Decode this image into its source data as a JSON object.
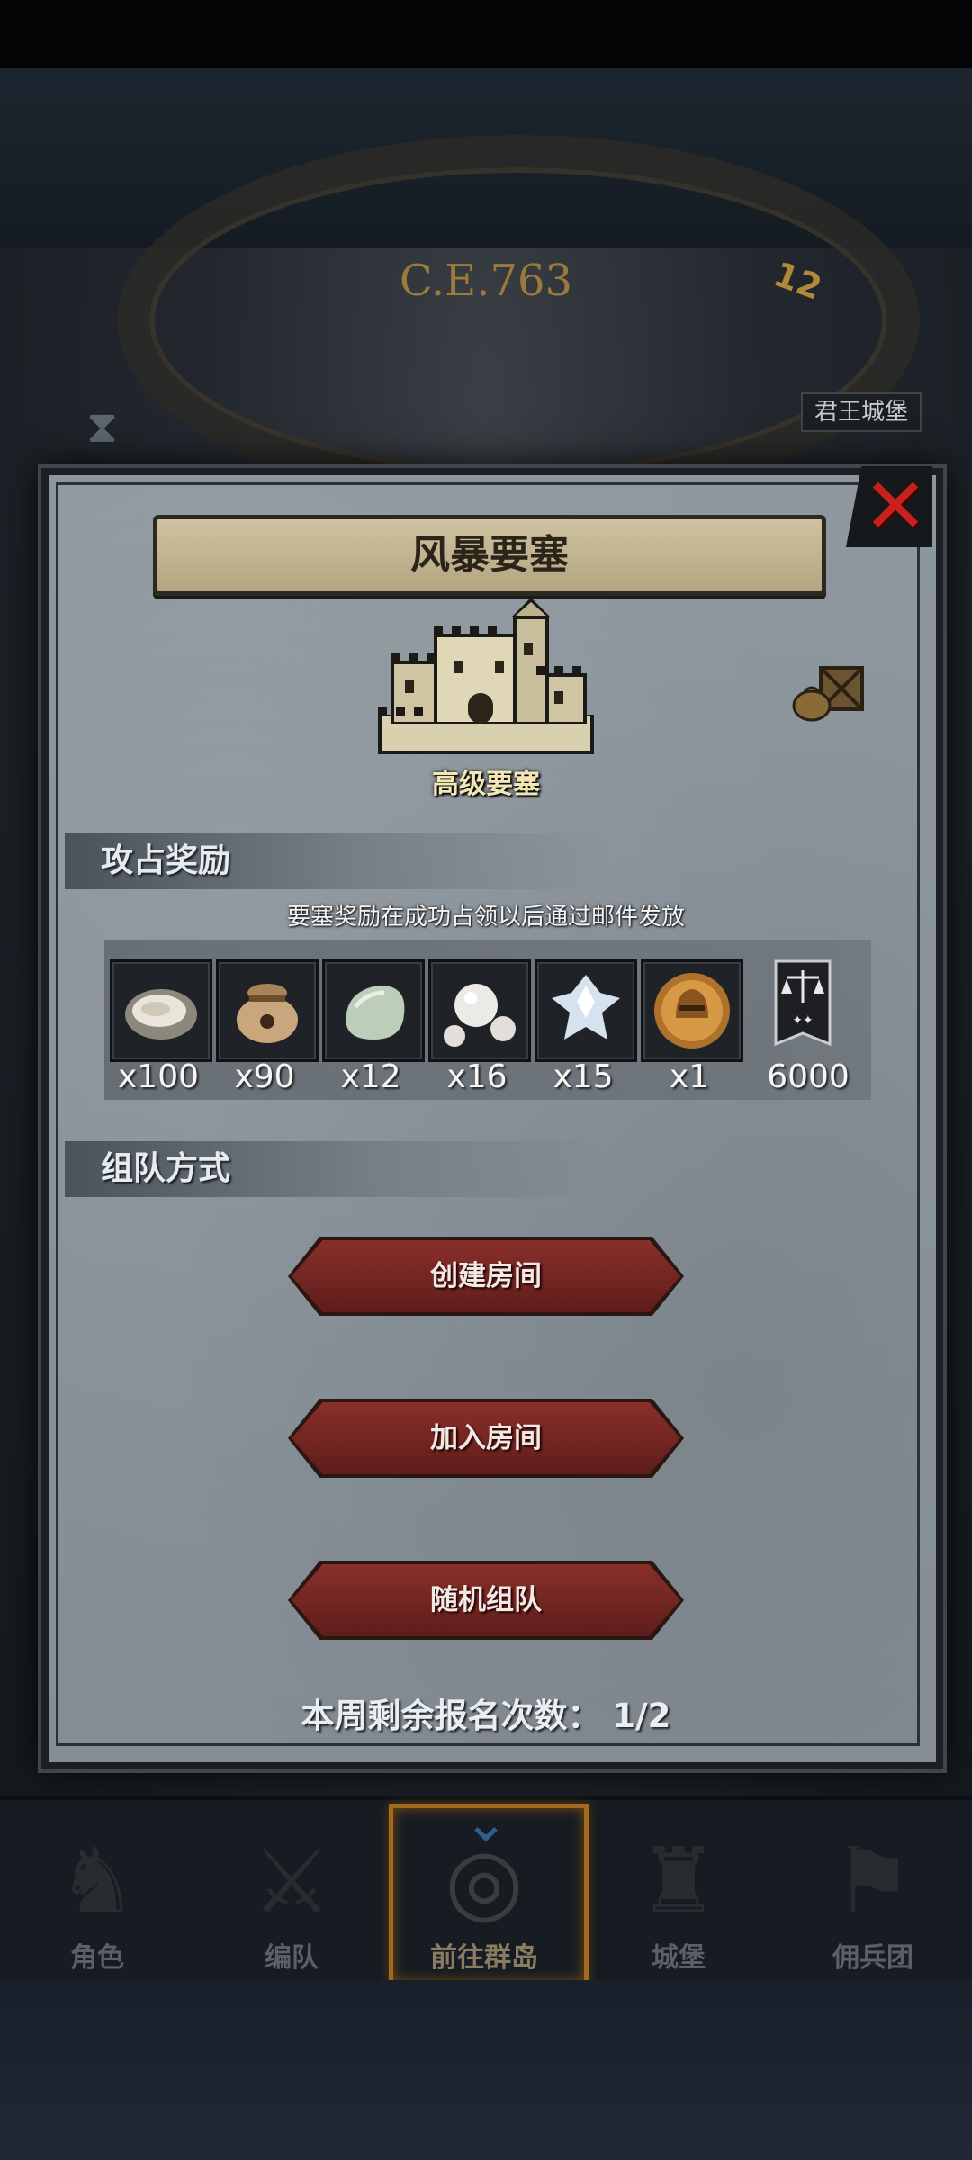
{
  "background": {
    "era": "C.E.763",
    "dial_number": "12",
    "side_label": "君王城堡"
  },
  "modal": {
    "title": "风暴要塞",
    "fortress_label": "高级要塞",
    "close_icon": "close-icon"
  },
  "rewards": {
    "title": "攻占奖励",
    "note": "要塞奖励在成功占领以后通过邮件发放",
    "items": [
      {
        "icon": "oyster-icon",
        "count": "x100"
      },
      {
        "icon": "pouch-icon",
        "count": "x90"
      },
      {
        "icon": "jade-stone-icon",
        "count": "x12"
      },
      {
        "icon": "pearls-icon",
        "count": "x16"
      },
      {
        "icon": "crystal-icon",
        "count": "x15"
      },
      {
        "icon": "knight-helmet-medal-icon",
        "count": "x1"
      },
      {
        "icon": "scales-banner-icon",
        "count": "6000"
      }
    ]
  },
  "team": {
    "title": "组队方式",
    "create_room": "创建房间",
    "join_room": "加入房间",
    "random_team": "随机组队",
    "remaining_label": "本周剩余报名次数： 1/2"
  },
  "nav": {
    "items": [
      {
        "label": "角色",
        "icon": "character-icon"
      },
      {
        "label": "编队",
        "icon": "formation-icon"
      },
      {
        "label": "前往群岛",
        "icon": "globe-icon"
      },
      {
        "label": "城堡",
        "icon": "castle-icon"
      },
      {
        "label": "佣兵团",
        "icon": "mercenary-icon"
      }
    ]
  },
  "colors": {
    "accent_red": "#c8201c",
    "button_red": "#7a2622",
    "nav_active": "#a26a1d"
  }
}
